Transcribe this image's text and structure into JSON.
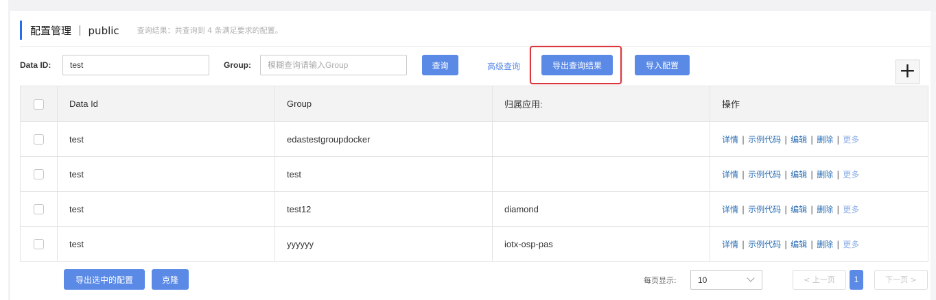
{
  "header": {
    "title": "配置管理 ｜ public",
    "summary": "查询结果：共查询到 4 条满足要求的配置。"
  },
  "search": {
    "data_id_label": "Data ID:",
    "data_id_value": "test",
    "group_label": "Group:",
    "group_placeholder": "模糊查询请输入Group",
    "query_button": "查询",
    "advanced_link": "高级查询",
    "export_results_button": "导出查询结果",
    "import_button": "导入配置",
    "add_icon": "plus-icon"
  },
  "table": {
    "columns": [
      "Data Id",
      "Group",
      "归属应用:",
      "操作"
    ],
    "rows": [
      {
        "data_id": "test",
        "group": "edastestgroupdocker",
        "app": ""
      },
      {
        "data_id": "test",
        "group": "test",
        "app": ""
      },
      {
        "data_id": "test",
        "group": "test12",
        "app": "diamond"
      },
      {
        "data_id": "test",
        "group": "yyyyyy",
        "app": "iotx-osp-pas"
      }
    ],
    "actions": [
      "详情",
      "示例代码",
      "编辑",
      "删除",
      "更多"
    ],
    "action_separator": "|"
  },
  "footer": {
    "export_selected_button": "导出选中的配置",
    "clone_button": "克隆",
    "page_size_label": "每页显示:",
    "page_size_value": "10",
    "prev_button": "< 上一页",
    "current_page": "1",
    "next_button": "下一页 >"
  },
  "colors": {
    "primary": "#5a8ae6",
    "link": "#2d6fb5",
    "highlight": "#d9363e",
    "header_accent": "#2b6de6"
  }
}
